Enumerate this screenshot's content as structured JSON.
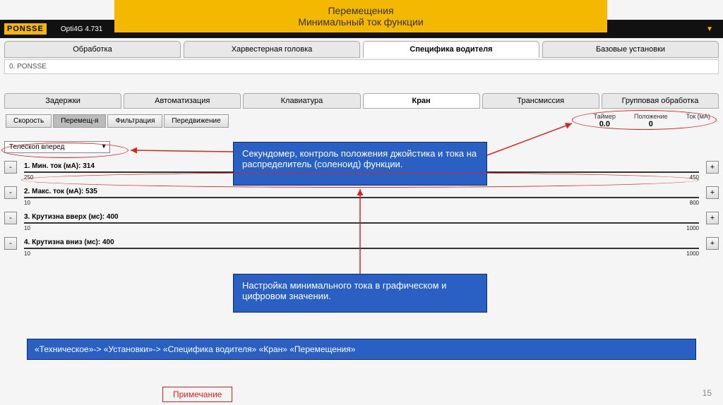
{
  "title": {
    "line1": "Перемещения",
    "line2": "Минимальный ток функции"
  },
  "logo": "PONSSE",
  "version": "Opti4G 4.731",
  "main_tabs": {
    "t0": "Обработка",
    "t1": "Харвестерная головка",
    "t2": "Специфика водителя",
    "t3": "Базовые установки"
  },
  "breadcrumb": "0. PONSSE",
  "sub_tabs": {
    "s0": "Задержки",
    "s1": "Автоматизация",
    "s2": "Клавиатура",
    "s3": "Кран",
    "s4": "Трансмиссия",
    "s5": "Групповая обработка"
  },
  "subsub": {
    "b0": "Скорость",
    "b1": "Перемещ-я",
    "b2": "Фильтрация",
    "b3": "Передвижение"
  },
  "meters": {
    "timer_label": "Таймер",
    "timer_value": "0.0",
    "pos_label": "Положение",
    "pos_value": "0",
    "cur_label": "Ток (мА)",
    "cur_value": ""
  },
  "dropdown": "Телескоп вперед",
  "params": {
    "p0": {
      "label": "1. Мин. ток  (мА): 314",
      "lo": "250",
      "hi": "450"
    },
    "p1": {
      "label": "2. Макс. ток  (мА): 535",
      "lo": "10",
      "hi": "800"
    },
    "p2": {
      "label": "3. Крутизна вверх (мс): 400",
      "lo": "10",
      "hi": "1000"
    },
    "p3": {
      "label": "4. Крутизна вниз (мс): 400",
      "lo": "10",
      "hi": "1000"
    }
  },
  "callout1": "Секундомер, контроль положения джойстика и тока на распределитель (соленоид) функции.",
  "callout2": " Настройка минимального тока в графическом и цифровом значении.",
  "path_bar": "«Техническое»-> «Установки»-> «Специфика водителя» «Кран» «Перемещения»",
  "note": "Примечание",
  "page_num": "15",
  "minus": "-",
  "plus": "+"
}
